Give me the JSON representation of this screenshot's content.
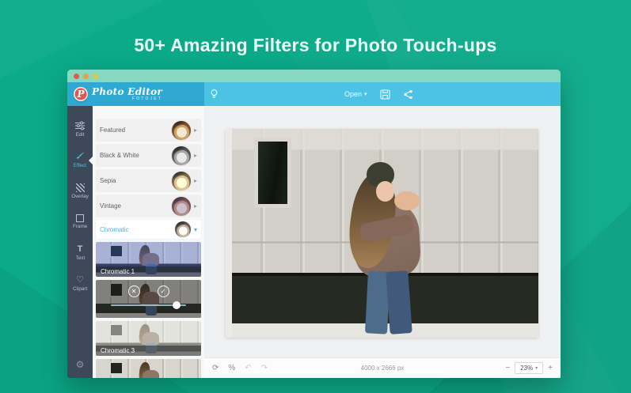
{
  "page": {
    "headline": "50+ Amazing Filters for Photo Touch-ups"
  },
  "colors": {
    "background_green": "#0BAB89",
    "titlebar_teal": "#87D8C1",
    "toolbar_blue": "#4CC2E4",
    "logo_bar_blue": "#30A9D2",
    "sidebar_navy": "#3D4859",
    "accent_blue": "#4AB4E0",
    "logo_red": "#E2584E",
    "traffic_dots": [
      "#E2574E",
      "#E9A13E",
      "#DCC94C"
    ]
  },
  "logo": {
    "monogram": "P",
    "brand": "Photo Editor",
    "subbrand": "FOTOJET"
  },
  "toolbar": {
    "open_label": "Open"
  },
  "sidebar": {
    "items": [
      {
        "label": "Edit",
        "active": false
      },
      {
        "label": "Effect",
        "active": true
      },
      {
        "label": "Overlay",
        "active": false
      },
      {
        "label": "Frame",
        "active": false
      },
      {
        "label": "Text",
        "active": false
      },
      {
        "label": "Clipart",
        "active": false
      }
    ]
  },
  "filters": {
    "categories": [
      {
        "label": "Featured"
      },
      {
        "label": "Black & White"
      },
      {
        "label": "Sepia"
      },
      {
        "label": "Vintage"
      }
    ],
    "active_category": "Chromatic",
    "thumbnails": [
      {
        "label": "Chromatic 1",
        "state": "normal"
      },
      {
        "label": "",
        "state": "selected"
      },
      {
        "label": "Chromatic 3",
        "state": "normal"
      },
      {
        "label": "",
        "state": "partial"
      }
    ],
    "selected_slider_percent": 82
  },
  "statusbar": {
    "image_size": "4000 x 2666 px",
    "zoom_level": "23%"
  },
  "glyphs": {
    "caret_down": "▾",
    "caret_right": "▸",
    "close": "✕",
    "check": "✓",
    "reset": "⟳",
    "compare": "%",
    "undo": "↶",
    "redo": "↷",
    "minus": "−",
    "plus": "+",
    "gear": "⚙",
    "heart": "♡",
    "text_tool": "T"
  }
}
